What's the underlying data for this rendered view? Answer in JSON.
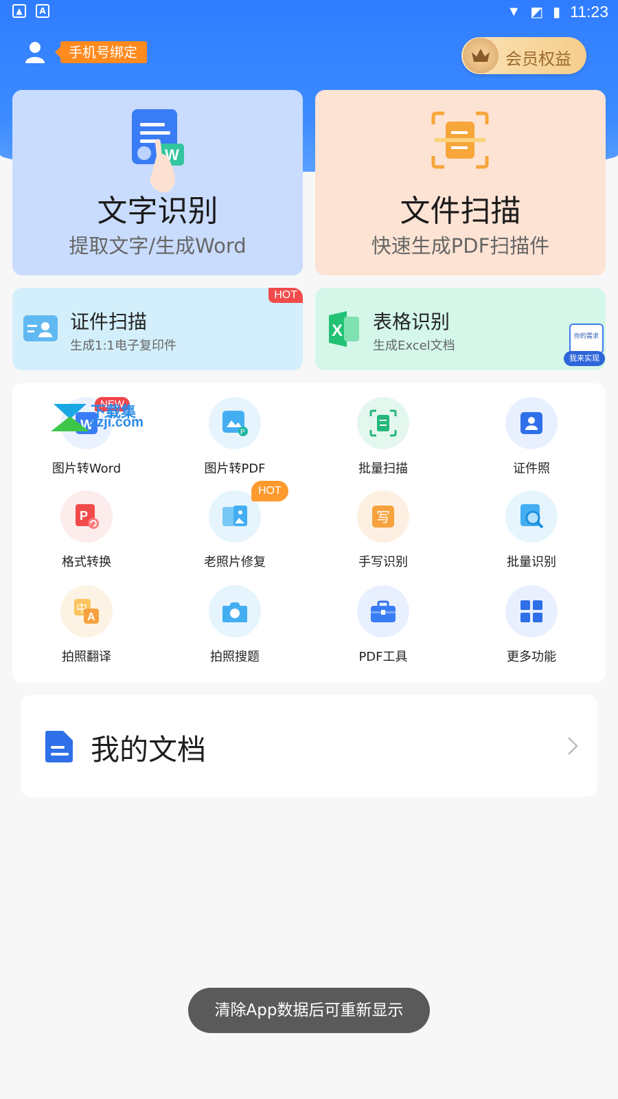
{
  "status_bar": {
    "time": "11:23"
  },
  "header": {
    "bind_label": "手机号绑定",
    "vip_label": "会员权益"
  },
  "big_cards": [
    {
      "title": "文字识别",
      "subtitle": "提取文字/生成Word"
    },
    {
      "title": "文件扫描",
      "subtitle": "快速生成PDF扫描件"
    }
  ],
  "mid_cards": [
    {
      "title": "证件扫描",
      "subtitle": "生成1:1电子复印件",
      "badge": "HOT"
    },
    {
      "title": "表格识别",
      "subtitle": "生成Excel文档",
      "float_line1": "你的需求",
      "float_line2": "我来实现"
    }
  ],
  "watermark": {
    "line1": "下载集",
    "line2": "xzji.com"
  },
  "tools": [
    {
      "label": "图片转Word",
      "badge": "NEW"
    },
    {
      "label": "图片转PDF"
    },
    {
      "label": "批量扫描"
    },
    {
      "label": "证件照"
    },
    {
      "label": "格式转换"
    },
    {
      "label": "老照片修复",
      "badge": "HOT"
    },
    {
      "label": "手写识别"
    },
    {
      "label": "批量识别"
    },
    {
      "label": "拍照翻译"
    },
    {
      "label": "拍照搜题"
    },
    {
      "label": "PDF工具"
    },
    {
      "label": "更多功能"
    }
  ],
  "docs": {
    "title": "我的文档"
  },
  "toast": {
    "text": "清除App数据后可重新显示"
  },
  "colors": {
    "primary": "#2f7dff",
    "orange": "#ff8a1e",
    "red": "#f24b4b"
  }
}
